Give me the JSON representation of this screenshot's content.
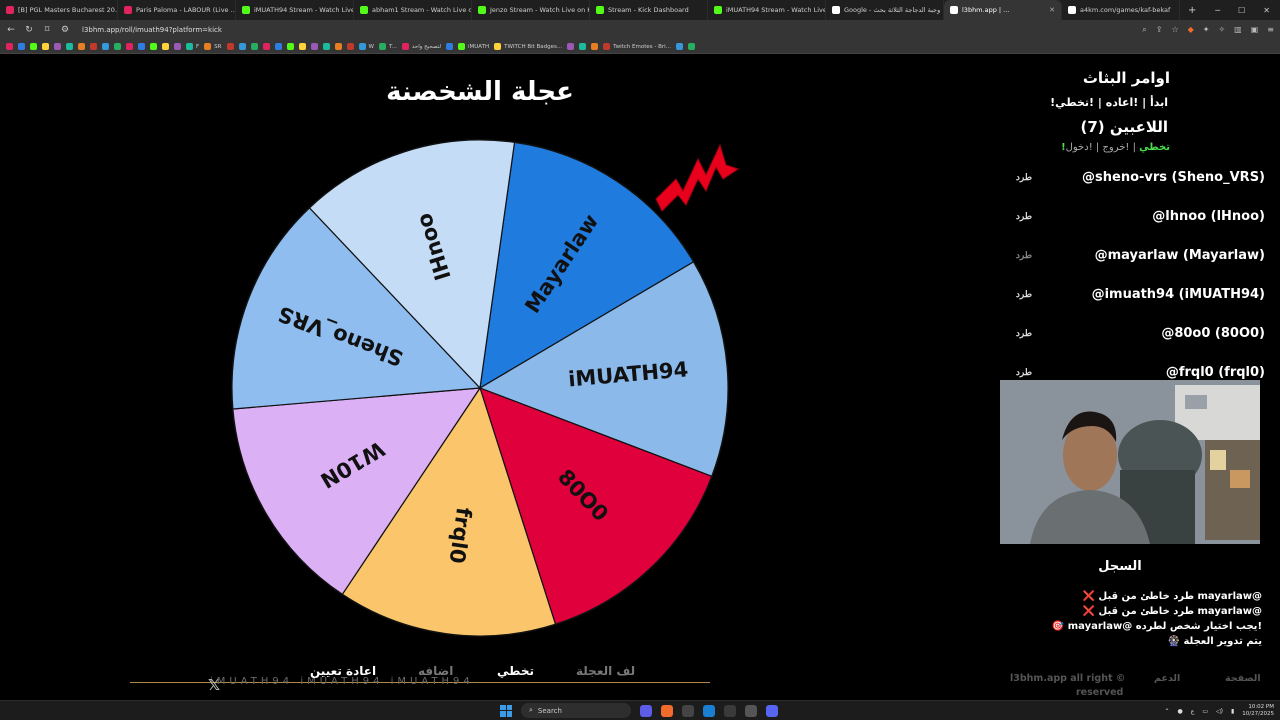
{
  "browser": {
    "tabs": [
      {
        "label": "[B] PGL Masters Bucharest 20...",
        "color": "#e0245e"
      },
      {
        "label": "Paris Paloma - LABOUR (Live ...",
        "color": "#e0245e"
      },
      {
        "label": "iMUATH94 Stream - Watch Live o...",
        "color": "#53fc18"
      },
      {
        "label": "abham1 Stream - Watch Live o...",
        "color": "#53fc18"
      },
      {
        "label": "Jenzo Stream - Watch Live on Kick",
        "color": "#53fc18"
      },
      {
        "label": "Stream - Kick Dashboard",
        "color": "#53fc18"
      },
      {
        "label": "iMUATH94 Stream - Watch Live ...",
        "color": "#53fc18"
      },
      {
        "label": "Google - وجبة الدجاجة الثلاثة بحث",
        "color": "#ffffff"
      },
      {
        "label": "l3bhm.app | ...",
        "color": "#ffffff",
        "active": true
      },
      {
        "label": "a4km.com/games/kaf-bekaf",
        "color": "#ffffff"
      }
    ],
    "url": "l3bhm.app/roll/imuath94?platform=kick",
    "bookmarks": [
      "",
      "",
      "",
      "",
      "",
      "",
      "",
      "",
      "",
      "",
      "",
      "",
      "",
      "",
      "",
      "F",
      "SR",
      "",
      "",
      "",
      "",
      "",
      "",
      "",
      "",
      "",
      "",
      "",
      "W",
      "T...",
      "لتصحيح واحد",
      "",
      "iMUATH",
      "TWITCH Bit Badges...",
      "",
      "",
      "",
      "Twitch Emotes - Bri...",
      "",
      ""
    ]
  },
  "wheel": {
    "title": "عجلة الشخصنة",
    "segments": [
      {
        "label": "Mayarlaw",
        "color": "#1f7bdd"
      },
      {
        "label": "iMUATH94",
        "color": "#8ab9ea"
      },
      {
        "label": "80O0",
        "color": "#e0003c"
      },
      {
        "label": "frql0",
        "color": "#fbc56b"
      },
      {
        "label": "W10N",
        "color": "#dcb0f5"
      },
      {
        "label": "Sheno_VRS",
        "color": "#90bdf0"
      },
      {
        "label": "lHnoo",
        "color": "#c4dcf6"
      }
    ]
  },
  "bottom_bar": {
    "reset": "اعادة تعيين",
    "add": "اضافه",
    "skip": "تخطي",
    "spin": "لف العجلة",
    "watermark": "iMUATH94  iMUATH94  iMUATH94"
  },
  "panel": {
    "host_commands_title": "اوامر البثاث",
    "host_commands": "!ابدأ | !اعاده | !تخطي",
    "players_title": "اللاعبين (7)",
    "player_cmds": {
      "join": "!دخول",
      "leave": "!خروج",
      "skip": "!تخطي",
      "sep": " | "
    },
    "kick_label": "طرد",
    "players": [
      {
        "name": "@sheno-vrs (Sheno_VRS)",
        "kick_active": true
      },
      {
        "name": "@lhnoo (lHnoo)",
        "kick_active": true
      },
      {
        "name": "@mayarlaw (Mayarlaw)",
        "kick_active": false
      },
      {
        "name": "@imuath94 (iMUATH94)",
        "kick_active": true
      },
      {
        "name": "@80o0 (80O0)",
        "kick_active": true
      },
      {
        "name": "@frql0 (frql0)",
        "kick_active": true
      }
    ],
    "log_title": "السجل",
    "log": [
      "❌ طرد خاطئ من قبل mayarlaw@",
      "❌ طرد خاطئ من قبل mayarlaw@",
      "🎯 mayarlaw@ يجب اختيار شخص لطرده!",
      "🎡 يتم تدوير العجلة"
    ]
  },
  "footer": {
    "copyright": "l3bhm.app all right ©",
    "reserved": "reserved",
    "support": "الدعم",
    "home": "الصفحة"
  },
  "taskbar": {
    "search": "Search",
    "time": "10:02 PM",
    "date": "10/27/2025"
  },
  "colors": {
    "pointer": "#e8001c",
    "accent_gold": "#b08848",
    "green": "#4be04b"
  }
}
